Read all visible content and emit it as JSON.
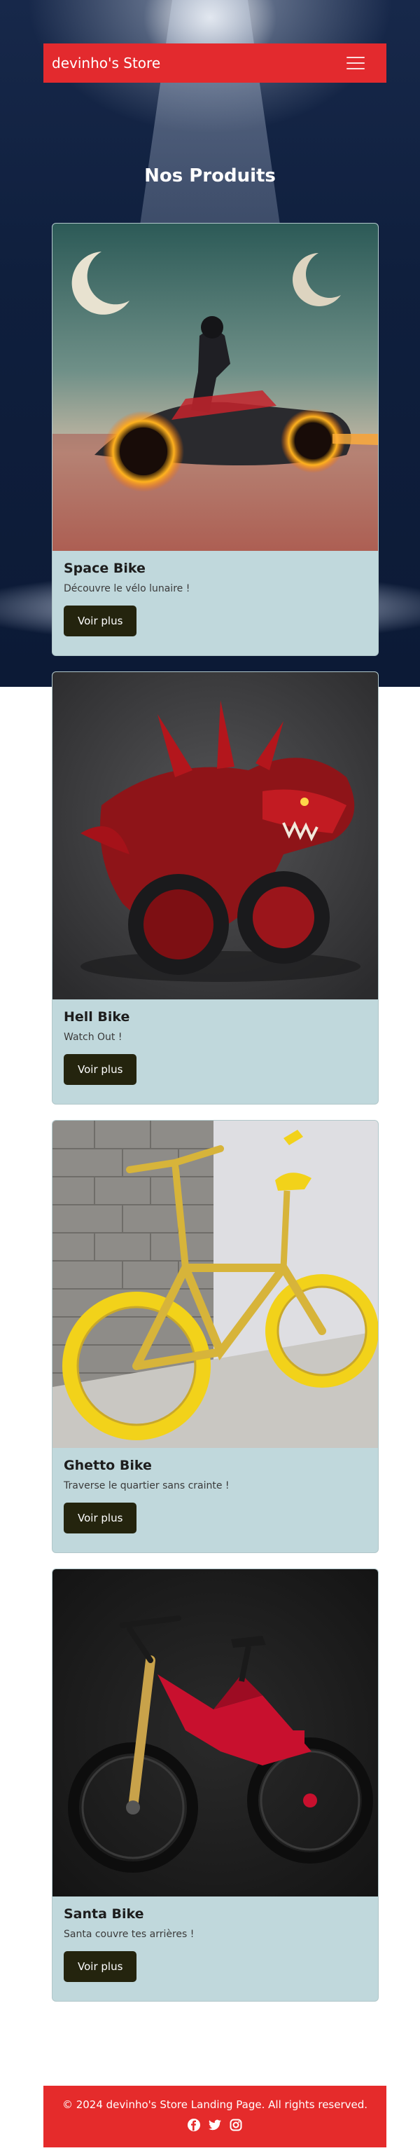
{
  "navbar": {
    "brand": "devinho's Store",
    "toggle_icon": "hamburger-menu-icon"
  },
  "products_section": {
    "title": "Nos Produits"
  },
  "products": [
    {
      "title": "Space Bike",
      "description": "Découvre le vélo lunaire !",
      "button_label": "Voir plus",
      "image": "futuristic glowing motorcycle with rider on reflective desert under twin moons"
    },
    {
      "title": "Hell Bike",
      "description": "Watch Out !",
      "button_label": "Voir plus",
      "image": "red demonic dragon-shaped motorcycle"
    },
    {
      "title": "Ghetto Bike",
      "description": "Traverse le quartier sans crainte !",
      "button_label": "Voir plus",
      "image": "gold BMX bike with yellow tires against a wall"
    },
    {
      "title": "Santa Bike",
      "description": "Santa couvre tes arrières !",
      "button_label": "Voir plus",
      "image": "red and black downhill mountain bike on dark background"
    }
  ],
  "footer": {
    "text": "© 2024 devinho's Store Landing Page. All rights reserved.",
    "social_icons": [
      "facebook-icon",
      "twitter-icon",
      "instagram-icon"
    ]
  },
  "colors": {
    "navbar": "#e32a2e",
    "footer": "#e52b2b",
    "card_body": "#c0d8dc",
    "button": "#24240e",
    "hero_background": "#0f1f3d"
  }
}
